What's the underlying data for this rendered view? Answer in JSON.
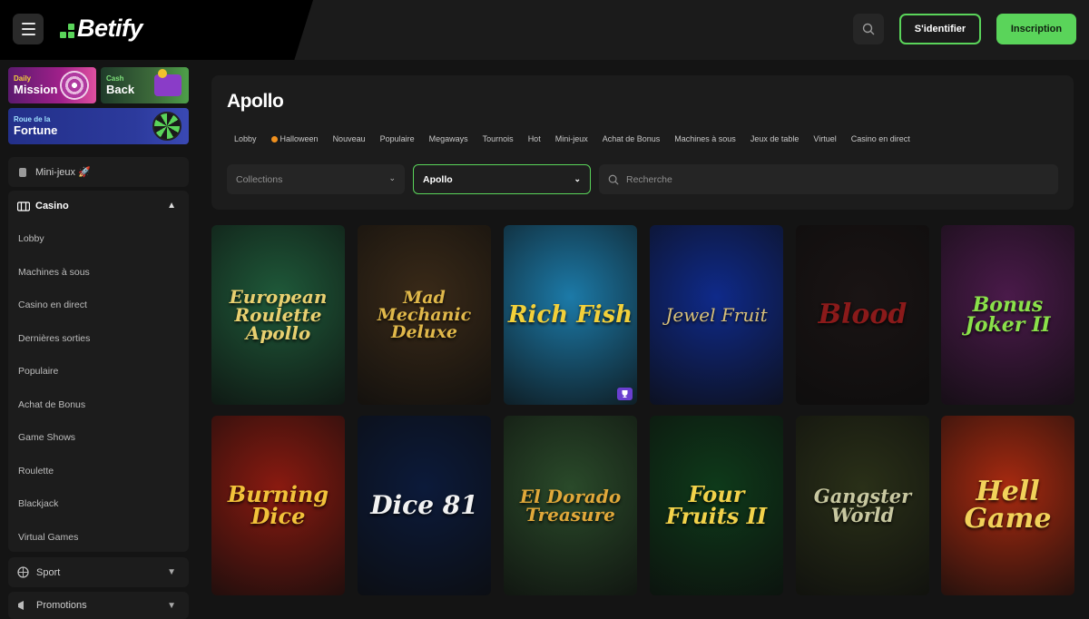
{
  "header": {
    "logo_text": "Betify",
    "login_label": "S'identifier",
    "signup_label": "Inscription",
    "accent": "#5ad45a"
  },
  "promos": {
    "mission": {
      "small": "Daily",
      "big": "Mission"
    },
    "cashback": {
      "small": "Cash",
      "big": "Back"
    },
    "fortune": {
      "small": "Roue de la",
      "big": "Fortune"
    }
  },
  "sidebar": {
    "mini_jeux": "Mini-jeux 🚀",
    "casino_label": "Casino",
    "casino_items": [
      "Lobby",
      "Machines à sous",
      "Casino en direct",
      "Dernières sorties",
      "Populaire",
      "Achat de Bonus",
      "Game Shows",
      "Roulette",
      "Blackjack",
      "Virtual Games"
    ],
    "sport_label": "Sport",
    "promotions_label": "Promotions"
  },
  "main": {
    "title": "Apollo",
    "tabs": [
      "Lobby",
      "Halloween",
      "Nouveau",
      "Populaire",
      "Megaways",
      "Tournois",
      "Hot",
      "Mini-jeux",
      "Achat de Bonus",
      "Machines à sous",
      "Jeux de table",
      "Virtuel",
      "Casino en direct"
    ],
    "collections_placeholder": "Collections",
    "provider_selected": "Apollo",
    "search_placeholder": "Recherche"
  },
  "games": [
    {
      "title": "European Roulette Apollo",
      "bg": "#1f5a3a",
      "color": "#e8d070"
    },
    {
      "title": "Mad Mechanic Deluxe",
      "bg": "#3a2a18",
      "color": "#e0b84a"
    },
    {
      "title": "Rich Fish",
      "bg": "#1c7aa8",
      "color": "#f2d03a"
    },
    {
      "title": "Jewel Fruit",
      "bg": "#0f2a8a",
      "color": "#d8c07a"
    },
    {
      "title": "Blood",
      "bg": "#1a1414",
      "color": "#8a1a1a"
    },
    {
      "title": "Bonus Joker II",
      "bg": "#4a1a4a",
      "color": "#8ae04a"
    },
    {
      "title": "Burning Dice",
      "bg": "#8a1a10",
      "color": "#f2c23a"
    },
    {
      "title": "Dice 81",
      "bg": "#0c1a3a",
      "color": "#f2f2f2"
    },
    {
      "title": "El Dorado Treasure",
      "bg": "#2a4a2a",
      "color": "#e0a83a"
    },
    {
      "title": "Four Fruits II",
      "bg": "#0e3a1a",
      "color": "#f2d24a"
    },
    {
      "title": "Gangster World",
      "bg": "#2a3018",
      "color": "#c8c8a0"
    },
    {
      "title": "Hell Game",
      "bg": "#a82a10",
      "color": "#f2d25a"
    }
  ]
}
